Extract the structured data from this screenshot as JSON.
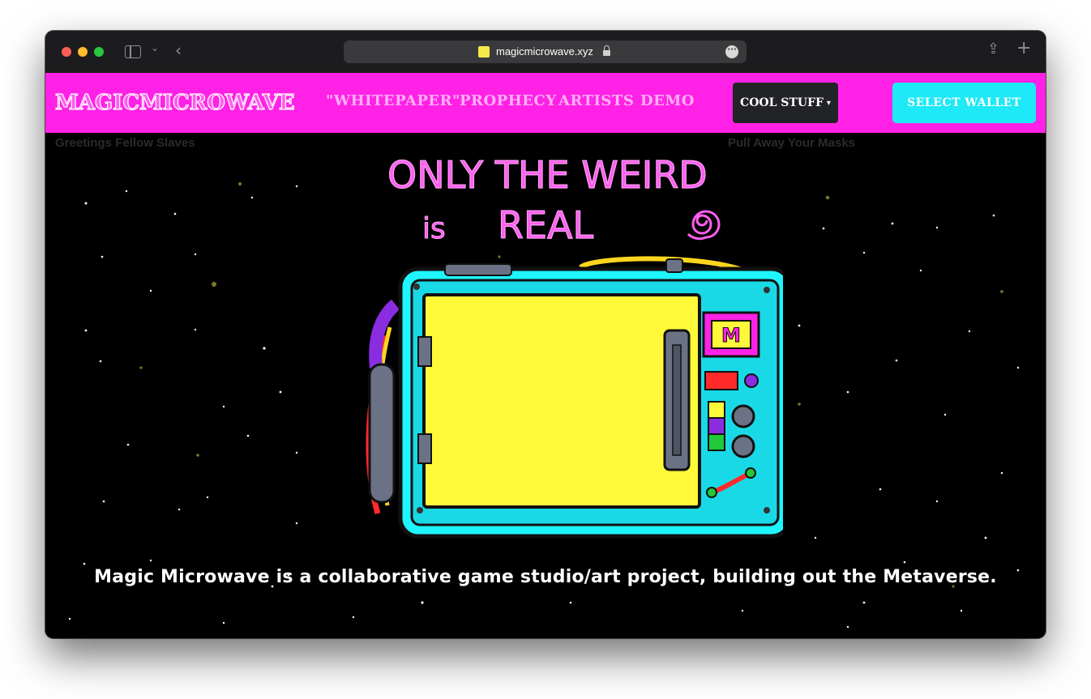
{
  "browser": {
    "url": "magicmicrowave.xyz"
  },
  "nav": {
    "logo": "MAGICMICROWAVE",
    "links": [
      "\"WHITEPAPER\"",
      "PROPHECY",
      "ARTISTS",
      "DEMO"
    ],
    "cool_stuff_label": "COOL STUFF",
    "select_wallet_label": "SELECT WALLET"
  },
  "hero": {
    "greeting_left": "Greetings Fellow Slaves",
    "greeting_right": "Pull Away Your Masks",
    "headline_line1": "ONLY THE WEIRD",
    "headline_line2_a": "is",
    "headline_line2_b": "REAL",
    "microwave_badge": "M",
    "tagline": "Magic Microwave is a collaborative game studio/art project, building out the Metaverse."
  },
  "colors": {
    "nav_bg": "#ff22e6",
    "wallet_button": "#1ee9f6",
    "cool_stuff_button": "#222326",
    "microwave_body": "#1ef5ff",
    "microwave_door": "#fff93a",
    "headline": "#ff5ef0"
  }
}
